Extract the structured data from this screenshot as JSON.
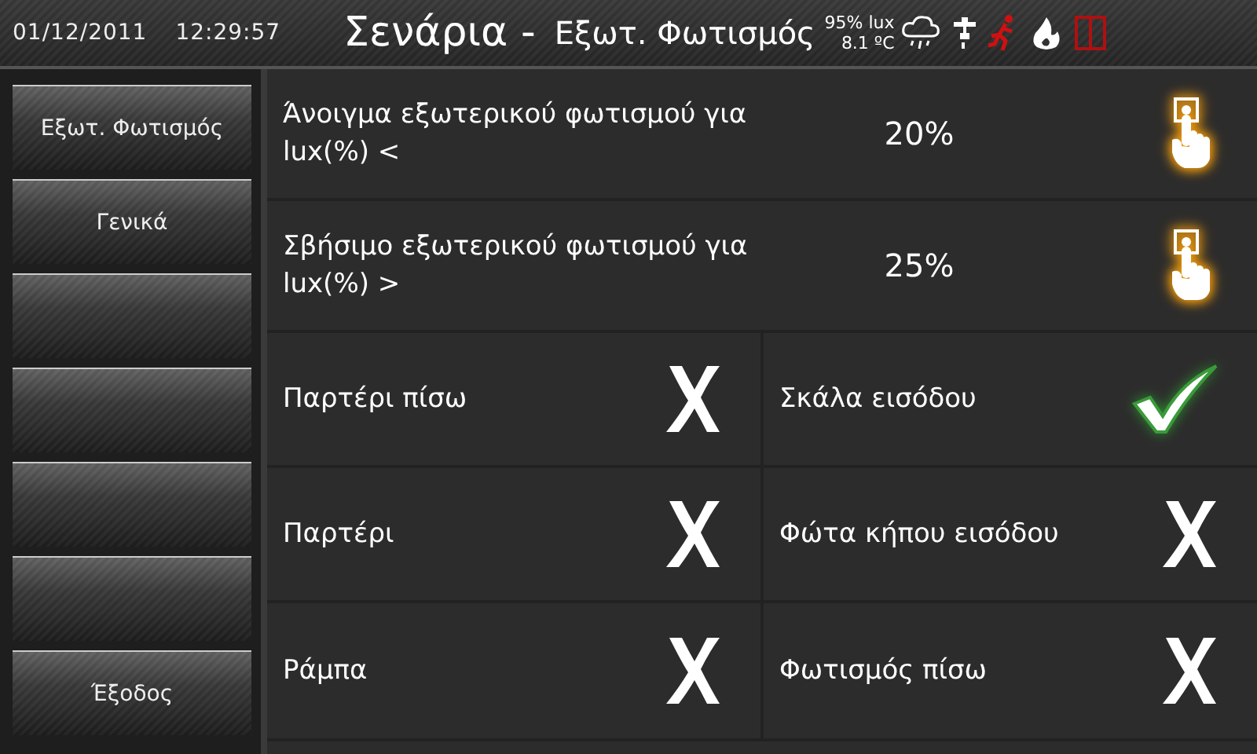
{
  "header": {
    "date": "01/12/2011",
    "time": "12:29:57",
    "title": "Σενάρια -",
    "subtitle": "Εξωτ. Φωτισμός",
    "humidity": "95%",
    "light_unit": "lux",
    "temperature": "8.1 ºC"
  },
  "sidebar": {
    "items": [
      {
        "kind": "labeled",
        "label": "Εξωτ. Φωτισμός"
      },
      {
        "kind": "labeled",
        "label": "Γενικά"
      },
      {
        "kind": "blank"
      },
      {
        "kind": "blank"
      },
      {
        "kind": "blank"
      },
      {
        "kind": "blank"
      },
      {
        "kind": "labeled",
        "label": "Έξοδος"
      }
    ]
  },
  "settings": [
    {
      "label": "Άνοιγμα εξωτερικού φωτισμού για lux(%) <",
      "value": "20%"
    },
    {
      "label": "Σβήσιμο εξωτερικού φωτισμού για lux(%) >",
      "value": "25%"
    }
  ],
  "toggle_rows": [
    [
      {
        "label": "Παρτέρι πίσω",
        "checked": false
      },
      {
        "label": "Σκάλα εισόδου",
        "checked": true
      }
    ],
    [
      {
        "label": "Παρτέρι",
        "checked": false
      },
      {
        "label": "Φώτα κήπου εισόδου",
        "checked": false
      }
    ],
    [
      {
        "label": "Ράμπα",
        "checked": false
      },
      {
        "label": "Φωτισμός πίσω",
        "checked": false
      }
    ]
  ]
}
